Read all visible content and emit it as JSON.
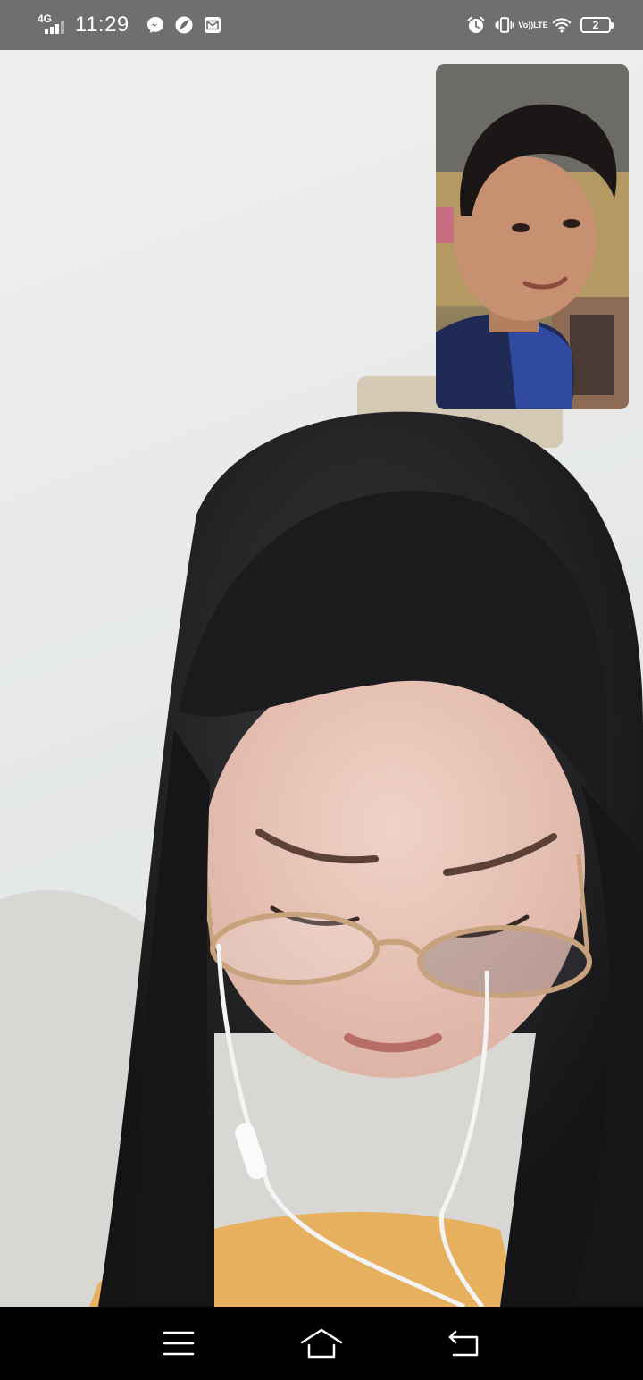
{
  "status_bar": {
    "network_type": "4G",
    "time": "11:29",
    "notification_icons": [
      "messenger-icon",
      "leaf-app-icon",
      "mail-icon"
    ],
    "system_icons": [
      "alarm-icon",
      "vibrate-icon",
      "volte-icon",
      "wifi-icon",
      "battery-icon"
    ],
    "volte_label_top": "Vo))",
    "volte_label_bottom": "LTE",
    "battery_level": "2"
  },
  "call": {
    "remote_video": "remote-participant-video",
    "self_video": "self-preview-video"
  },
  "nav_bar": {
    "buttons": [
      "menu-icon",
      "home-icon",
      "back-icon"
    ]
  }
}
